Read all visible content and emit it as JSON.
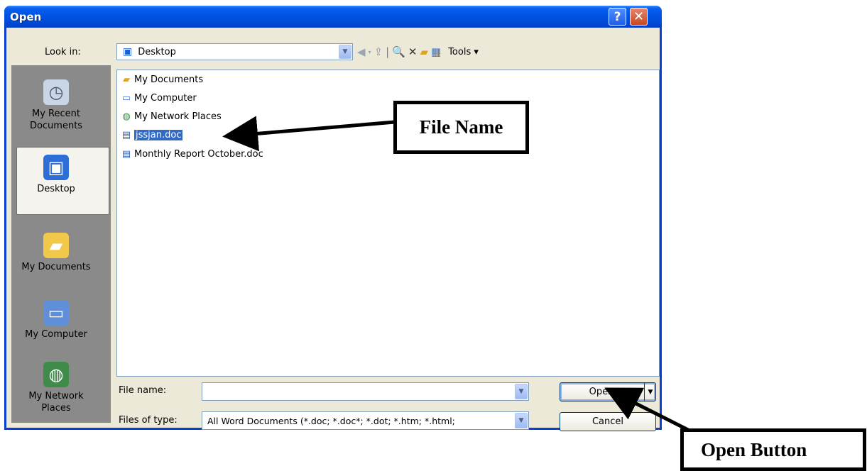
{
  "window": {
    "title": "Open",
    "help_glyph": "?",
    "close_glyph": "✕"
  },
  "toolbar": {
    "lookin_label": "Look in:",
    "lookin_value": "Desktop",
    "tools_label": "Tools ▾"
  },
  "places": [
    {
      "label": "My Recent\nDocuments",
      "icon": "recent-documents-icon"
    },
    {
      "label": "Desktop",
      "icon": "desktop-icon"
    },
    {
      "label": "My Documents",
      "icon": "my-documents-icon"
    },
    {
      "label": "My Computer",
      "icon": "my-computer-icon"
    },
    {
      "label": "My Network\nPlaces",
      "icon": "network-places-icon"
    }
  ],
  "files": [
    {
      "name": "My Documents",
      "icon": "folder-icon"
    },
    {
      "name": "My Computer",
      "icon": "computer-icon"
    },
    {
      "name": "My Network Places",
      "icon": "network-icon"
    },
    {
      "name": "jssjan.doc",
      "icon": "word-doc-icon",
      "selected": true
    },
    {
      "name": "Monthly Report October.doc",
      "icon": "word-doc-icon"
    }
  ],
  "form": {
    "filename_label": "File name:",
    "filename_value": "",
    "filetype_label": "Files of type:",
    "filetype_value": "All Word Documents (*.doc; *.doc*; *.dot; *.htm; *.html;"
  },
  "buttons": {
    "open_label": "Open",
    "cancel_label": "Cancel"
  },
  "annotations": {
    "file_name_callout": "File Name",
    "open_button_callout": "Open Button"
  }
}
